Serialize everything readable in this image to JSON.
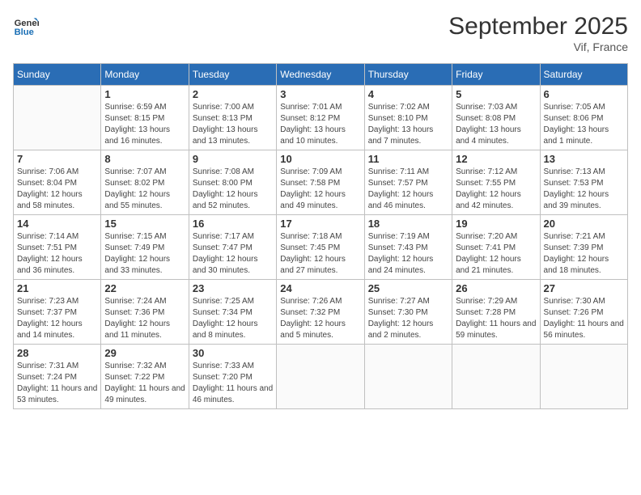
{
  "header": {
    "logo_line1": "General",
    "logo_line2": "Blue",
    "month": "September 2025",
    "location": "Vif, France"
  },
  "weekdays": [
    "Sunday",
    "Monday",
    "Tuesday",
    "Wednesday",
    "Thursday",
    "Friday",
    "Saturday"
  ],
  "weeks": [
    [
      {
        "day": "",
        "sunrise": "",
        "sunset": "",
        "daylight": ""
      },
      {
        "day": "1",
        "sunrise": "Sunrise: 6:59 AM",
        "sunset": "Sunset: 8:15 PM",
        "daylight": "Daylight: 13 hours and 16 minutes."
      },
      {
        "day": "2",
        "sunrise": "Sunrise: 7:00 AM",
        "sunset": "Sunset: 8:13 PM",
        "daylight": "Daylight: 13 hours and 13 minutes."
      },
      {
        "day": "3",
        "sunrise": "Sunrise: 7:01 AM",
        "sunset": "Sunset: 8:12 PM",
        "daylight": "Daylight: 13 hours and 10 minutes."
      },
      {
        "day": "4",
        "sunrise": "Sunrise: 7:02 AM",
        "sunset": "Sunset: 8:10 PM",
        "daylight": "Daylight: 13 hours and 7 minutes."
      },
      {
        "day": "5",
        "sunrise": "Sunrise: 7:03 AM",
        "sunset": "Sunset: 8:08 PM",
        "daylight": "Daylight: 13 hours and 4 minutes."
      },
      {
        "day": "6",
        "sunrise": "Sunrise: 7:05 AM",
        "sunset": "Sunset: 8:06 PM",
        "daylight": "Daylight: 13 hours and 1 minute."
      }
    ],
    [
      {
        "day": "7",
        "sunrise": "Sunrise: 7:06 AM",
        "sunset": "Sunset: 8:04 PM",
        "daylight": "Daylight: 12 hours and 58 minutes."
      },
      {
        "day": "8",
        "sunrise": "Sunrise: 7:07 AM",
        "sunset": "Sunset: 8:02 PM",
        "daylight": "Daylight: 12 hours and 55 minutes."
      },
      {
        "day": "9",
        "sunrise": "Sunrise: 7:08 AM",
        "sunset": "Sunset: 8:00 PM",
        "daylight": "Daylight: 12 hours and 52 minutes."
      },
      {
        "day": "10",
        "sunrise": "Sunrise: 7:09 AM",
        "sunset": "Sunset: 7:58 PM",
        "daylight": "Daylight: 12 hours and 49 minutes."
      },
      {
        "day": "11",
        "sunrise": "Sunrise: 7:11 AM",
        "sunset": "Sunset: 7:57 PM",
        "daylight": "Daylight: 12 hours and 46 minutes."
      },
      {
        "day": "12",
        "sunrise": "Sunrise: 7:12 AM",
        "sunset": "Sunset: 7:55 PM",
        "daylight": "Daylight: 12 hours and 42 minutes."
      },
      {
        "day": "13",
        "sunrise": "Sunrise: 7:13 AM",
        "sunset": "Sunset: 7:53 PM",
        "daylight": "Daylight: 12 hours and 39 minutes."
      }
    ],
    [
      {
        "day": "14",
        "sunrise": "Sunrise: 7:14 AM",
        "sunset": "Sunset: 7:51 PM",
        "daylight": "Daylight: 12 hours and 36 minutes."
      },
      {
        "day": "15",
        "sunrise": "Sunrise: 7:15 AM",
        "sunset": "Sunset: 7:49 PM",
        "daylight": "Daylight: 12 hours and 33 minutes."
      },
      {
        "day": "16",
        "sunrise": "Sunrise: 7:17 AM",
        "sunset": "Sunset: 7:47 PM",
        "daylight": "Daylight: 12 hours and 30 minutes."
      },
      {
        "day": "17",
        "sunrise": "Sunrise: 7:18 AM",
        "sunset": "Sunset: 7:45 PM",
        "daylight": "Daylight: 12 hours and 27 minutes."
      },
      {
        "day": "18",
        "sunrise": "Sunrise: 7:19 AM",
        "sunset": "Sunset: 7:43 PM",
        "daylight": "Daylight: 12 hours and 24 minutes."
      },
      {
        "day": "19",
        "sunrise": "Sunrise: 7:20 AM",
        "sunset": "Sunset: 7:41 PM",
        "daylight": "Daylight: 12 hours and 21 minutes."
      },
      {
        "day": "20",
        "sunrise": "Sunrise: 7:21 AM",
        "sunset": "Sunset: 7:39 PM",
        "daylight": "Daylight: 12 hours and 18 minutes."
      }
    ],
    [
      {
        "day": "21",
        "sunrise": "Sunrise: 7:23 AM",
        "sunset": "Sunset: 7:37 PM",
        "daylight": "Daylight: 12 hours and 14 minutes."
      },
      {
        "day": "22",
        "sunrise": "Sunrise: 7:24 AM",
        "sunset": "Sunset: 7:36 PM",
        "daylight": "Daylight: 12 hours and 11 minutes."
      },
      {
        "day": "23",
        "sunrise": "Sunrise: 7:25 AM",
        "sunset": "Sunset: 7:34 PM",
        "daylight": "Daylight: 12 hours and 8 minutes."
      },
      {
        "day": "24",
        "sunrise": "Sunrise: 7:26 AM",
        "sunset": "Sunset: 7:32 PM",
        "daylight": "Daylight: 12 hours and 5 minutes."
      },
      {
        "day": "25",
        "sunrise": "Sunrise: 7:27 AM",
        "sunset": "Sunset: 7:30 PM",
        "daylight": "Daylight: 12 hours and 2 minutes."
      },
      {
        "day": "26",
        "sunrise": "Sunrise: 7:29 AM",
        "sunset": "Sunset: 7:28 PM",
        "daylight": "Daylight: 11 hours and 59 minutes."
      },
      {
        "day": "27",
        "sunrise": "Sunrise: 7:30 AM",
        "sunset": "Sunset: 7:26 PM",
        "daylight": "Daylight: 11 hours and 56 minutes."
      }
    ],
    [
      {
        "day": "28",
        "sunrise": "Sunrise: 7:31 AM",
        "sunset": "Sunset: 7:24 PM",
        "daylight": "Daylight: 11 hours and 53 minutes."
      },
      {
        "day": "29",
        "sunrise": "Sunrise: 7:32 AM",
        "sunset": "Sunset: 7:22 PM",
        "daylight": "Daylight: 11 hours and 49 minutes."
      },
      {
        "day": "30",
        "sunrise": "Sunrise: 7:33 AM",
        "sunset": "Sunset: 7:20 PM",
        "daylight": "Daylight: 11 hours and 46 minutes."
      },
      {
        "day": "",
        "sunrise": "",
        "sunset": "",
        "daylight": ""
      },
      {
        "day": "",
        "sunrise": "",
        "sunset": "",
        "daylight": ""
      },
      {
        "day": "",
        "sunrise": "",
        "sunset": "",
        "daylight": ""
      },
      {
        "day": "",
        "sunrise": "",
        "sunset": "",
        "daylight": ""
      }
    ]
  ]
}
